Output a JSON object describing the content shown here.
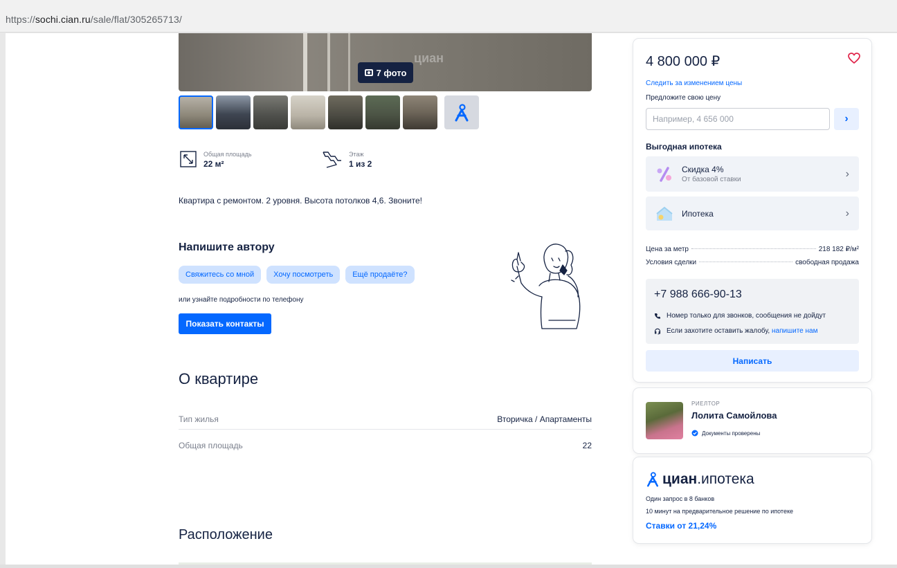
{
  "browser": {
    "url_prefix": "https://",
    "url_host": "sochi.cian.ru",
    "url_path": "/sale/flat/305265713/"
  },
  "gallery": {
    "photo_button_label": "7 фото",
    "watermark": "циан",
    "thumbnail_count": 7
  },
  "features": [
    {
      "label": "Общая площадь",
      "value": "22 м²",
      "icon": "area-icon"
    },
    {
      "label": "Этаж",
      "value": "1 из 2",
      "icon": "stairs-icon"
    }
  ],
  "description": "Квартира с ремонтом. 2 уровня. Высота потолков 4,6. Звоните!",
  "write_author": {
    "title": "Напишите автору",
    "chips": [
      "Свяжитесь со мной",
      "Хочу посмотреть",
      "Ещё продаёте?"
    ],
    "or_phone": "или узнайте подробности по телефону",
    "show_contacts": "Показать контакты"
  },
  "about": {
    "title": "О квартире",
    "rows": [
      {
        "key": "Тип жилья",
        "value": "Вторичка / Апартаменты"
      },
      {
        "key": "Общая площадь",
        "value": "22"
      }
    ]
  },
  "location": {
    "title": "Расположение"
  },
  "price_card": {
    "price": "4 800 000 ₽",
    "follow_price": "Следить за изменением цены",
    "offer_label": "Предложите свою цену",
    "offer_placeholder": "Например, 4 656 000",
    "mortgage_title": "Выгодная ипотека",
    "discount_title": "Скидка 4%",
    "discount_sub": "От базовой ставки",
    "mortgage_item": "Ипотека",
    "price_per_meter_label": "Цена за метр",
    "price_per_meter_value": "218 182 ₽/м²",
    "deal_label": "Условия сделки",
    "deal_value": "свободная продажа",
    "phone": "+7 988 666-90-13",
    "note_calls": "Номер только для звонков, сообщения не дойдут",
    "note_complaint": "Если захотите оставить жалобу,",
    "note_complaint_link": "напишите нам",
    "write_button": "Написать"
  },
  "realtor": {
    "tag": "РИЕЛТОР",
    "name": "Лолита Самойлова",
    "docs": "Документы проверены"
  },
  "cian_mortgage": {
    "logo_bold": "циан",
    "logo_rest": ".ипотека",
    "line1": "Один запрос в 8 банков",
    "line2": "10 минут на предварительное решение по ипотеке",
    "rates": "Ставки от 21,24%"
  },
  "colors": {
    "accent": "#0468ff",
    "text": "#152242",
    "heart": "#e0244a"
  }
}
